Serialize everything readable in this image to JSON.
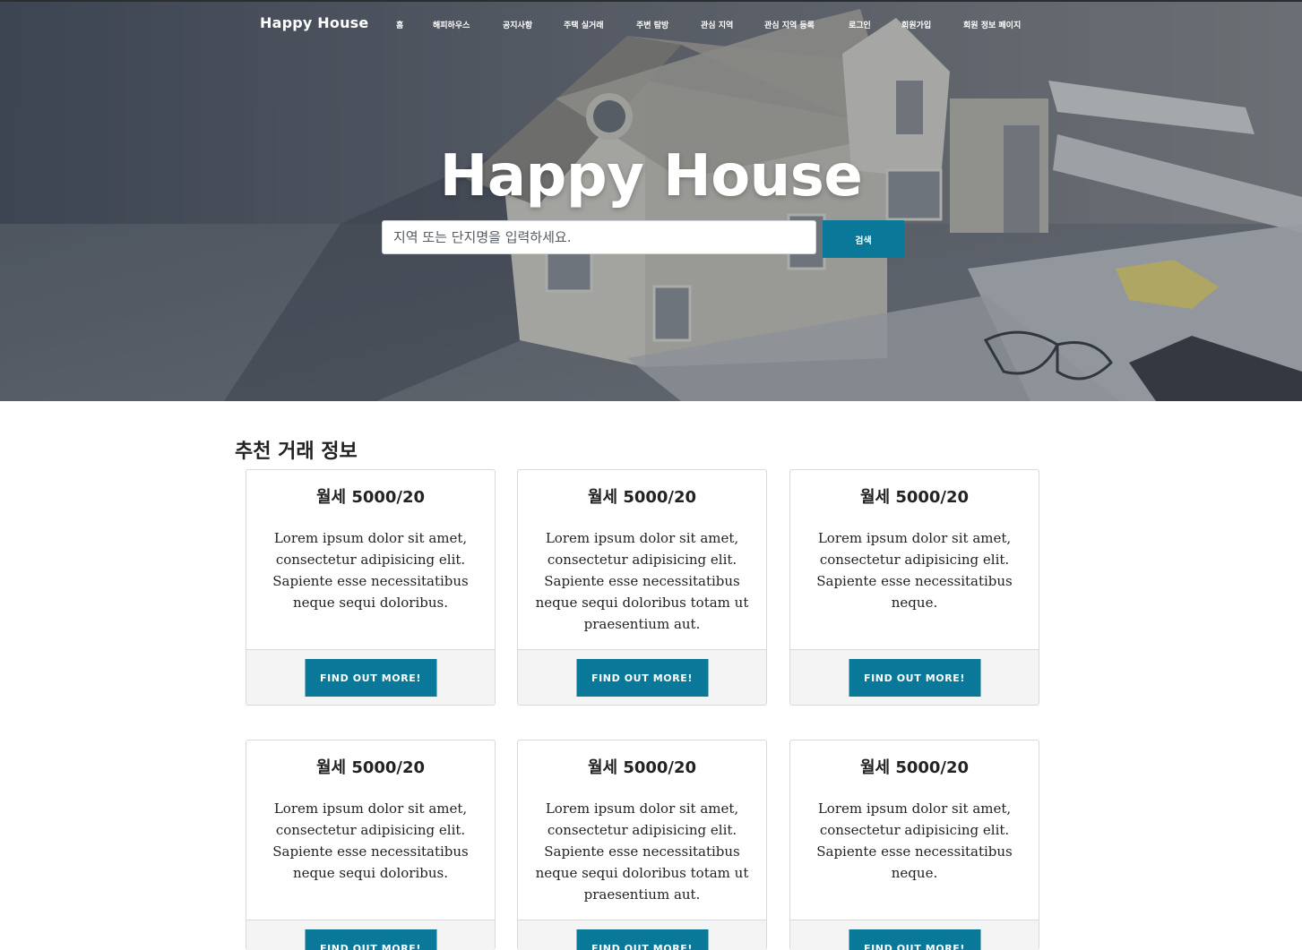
{
  "nav": {
    "brand": "Happy House",
    "items": [
      "홈",
      "해피하우스",
      "공지사항",
      "주택 실거래",
      "주변 탐방",
      "관심 지역",
      "관심 지역 등록",
      "로그인",
      "회원가입",
      "회원 정보 페이지"
    ]
  },
  "hero": {
    "title": "Happy House",
    "search_placeholder": "지역 또는 단지명을 입력하세요.",
    "search_button": "검색"
  },
  "section": {
    "title": "추천 거래 정보"
  },
  "cards": [
    {
      "title": "월세 5000/20",
      "text": "Lorem ipsum dolor sit amet, consectetur adipisicing elit. Sapiente esse necessitatibus neque sequi doloribus.",
      "button": "FIND OUT MORE!"
    },
    {
      "title": "월세 5000/20",
      "text": "Lorem ipsum dolor sit amet, consectetur adipisicing elit. Sapiente esse necessitatibus neque sequi doloribus totam ut praesentium aut.",
      "button": "FIND OUT MORE!"
    },
    {
      "title": "월세 5000/20",
      "text": "Lorem ipsum dolor sit amet, consectetur adipisicing elit. Sapiente esse necessitatibus neque.",
      "button": "FIND OUT MORE!"
    },
    {
      "title": "월세 5000/20",
      "text": "Lorem ipsum dolor sit amet, consectetur adipisicing elit. Sapiente esse necessitatibus neque sequi doloribus.",
      "button": "FIND OUT MORE!"
    },
    {
      "title": "월세 5000/20",
      "text": "Lorem ipsum dolor sit amet, consectetur adipisicing elit. Sapiente esse necessitatibus neque sequi doloribus totam ut praesentium aut.",
      "button": "FIND OUT MORE!"
    },
    {
      "title": "월세 5000/20",
      "text": "Lorem ipsum dolor sit amet, consectetur adipisicing elit. Sapiente esse necessitatibus neque.",
      "button": "FIND OUT MORE!"
    }
  ],
  "colors": {
    "accent": "#0a7999",
    "card_footer": "#f4f4f4"
  }
}
